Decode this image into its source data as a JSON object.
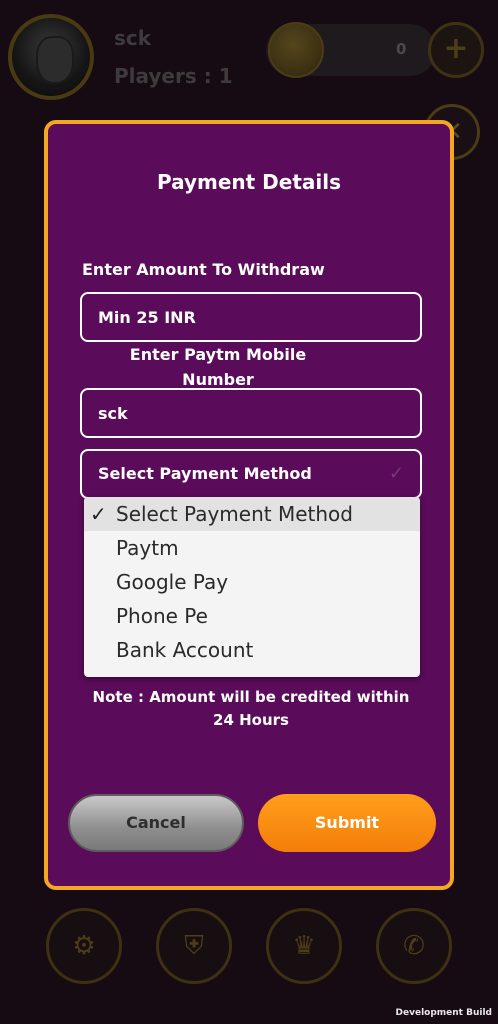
{
  "background": {
    "player_name": "sck",
    "players_label": "Players : 1",
    "coin_count": "0",
    "add_icon": "plus-icon",
    "close_icon": "close-icon",
    "nav_icons": [
      "gear-icon",
      "shield-check-icon",
      "crown-icon",
      "whatsapp-icon"
    ]
  },
  "modal": {
    "title": "Payment Details",
    "amount_label": "Enter Amount To Withdraw",
    "amount_placeholder": "Min 25 INR",
    "paytm_label": "Enter Paytm Mobile Number",
    "paytm_value": "sck",
    "payment_method_selected": "Select Payment Method",
    "payment_methods": [
      "Select Payment Method",
      "Paytm",
      "Google Pay",
      "Phone Pe",
      "Bank Account"
    ],
    "note": "Note : Amount will be credited within 24 Hours",
    "cancel_label": "Cancel",
    "submit_label": "Submit"
  },
  "footer": {
    "build_label": "Development Build"
  },
  "colors": {
    "modal_bg": "#5a0b59",
    "modal_border": "#f5a623",
    "submit": "#f47e0a",
    "cancel": "#8e8e8e"
  }
}
